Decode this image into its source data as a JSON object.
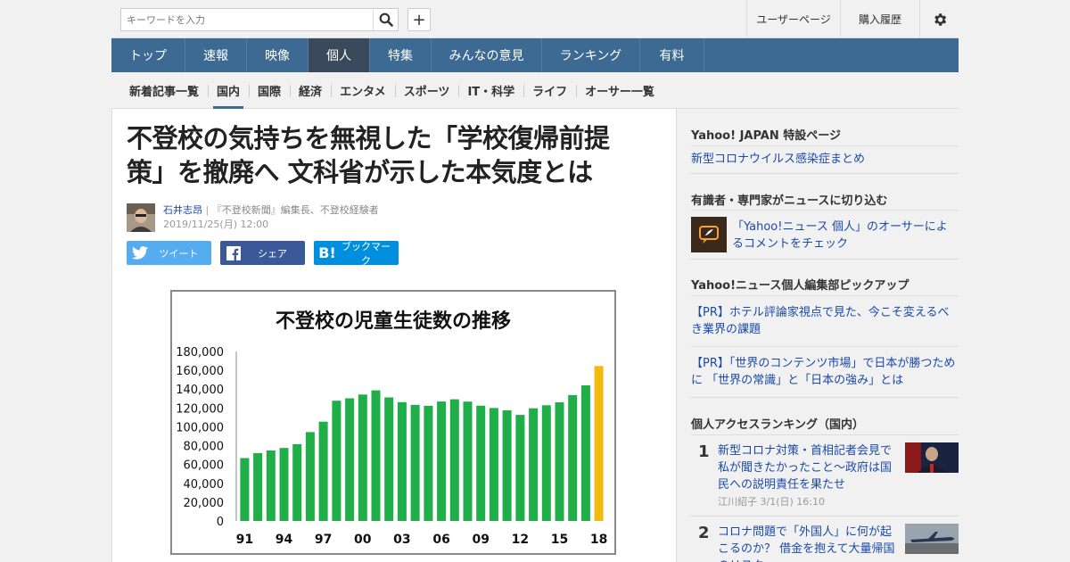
{
  "topbar": {
    "search_placeholder": "キーワードを入力",
    "user_page": "ユーザーページ",
    "purchase_history": "購入履歴"
  },
  "main_nav": [
    "トップ",
    "速報",
    "映像",
    "個人",
    "特集",
    "みんなの意見",
    "ランキング",
    "有料"
  ],
  "main_nav_active": "個人",
  "sub_nav": [
    "新着記事一覧",
    "国内",
    "国際",
    "経済",
    "エンタメ",
    "スポーツ",
    "IT・科学",
    "ライフ",
    "オーサー一覧"
  ],
  "sub_nav_active": "国内",
  "article": {
    "title_line1": "不登校の気持ちを無視した「学校復帰前提",
    "title_line2": "策」を撤廃へ 文科省が示した本気度とは",
    "author_name": "石井志昂",
    "author_sep": "|",
    "author_desc": "『不登校新聞』編集長、不登校経験者",
    "date": "2019/11/25(月) 12:00",
    "share_tweet": "ツイート",
    "share_facebook": "シェア",
    "share_hatena": "ブックマーク"
  },
  "chart_data": {
    "type": "bar",
    "title": "不登校の児童生徒数の推移",
    "x_tick_labels": [
      "91",
      "94",
      "97",
      "00",
      "03",
      "06",
      "09",
      "12",
      "15",
      "18"
    ],
    "categories": [
      "91",
      "92",
      "93",
      "94",
      "95",
      "96",
      "97",
      "98",
      "99",
      "00",
      "01",
      "02",
      "03",
      "04",
      "05",
      "06",
      "07",
      "08",
      "09",
      "10",
      "11",
      "12",
      "13",
      "14",
      "15",
      "16",
      "17",
      "18"
    ],
    "values": [
      66817,
      72131,
      74808,
      77449,
      81591,
      94351,
      105466,
      127692,
      130228,
      134286,
      138722,
      131252,
      126226,
      123358,
      122287,
      126894,
      129255,
      126805,
      122432,
      119891,
      117458,
      112689,
      119617,
      122897,
      125991,
      133683,
      144031,
      164528
    ],
    "ylim": [
      0,
      180000
    ],
    "y_ticks": [
      "180,000",
      "160,000",
      "140,000",
      "120,000",
      "100,000",
      "80,000",
      "60,000",
      "40,000",
      "20,000",
      "0"
    ],
    "colors": {
      "bar": "#1fae48",
      "highlight": "#f2b90f"
    },
    "highlight_last": true
  },
  "sidebar": {
    "special_heading": "Yahoo! JAPAN 特設ページ",
    "special_link": "新型コロナウイルス感染症まとめ",
    "experts_heading": "有識者・専門家がニュースに切り込む",
    "experts_link": "「Yahoo!ニュース 個人」のオーサーによるコメントをチェック",
    "pickup_heading": "Yahoo!ニュース個人編集部ピックアップ",
    "pickup_1": "【PR】ホテル評論家視点で見た、今こそ変えるべき業界の課題",
    "pickup_2": "【PR】「世界のコンテンツ市場」で日本が勝つために 「世界の常識」と「日本の強み」とは",
    "ranking_heading": "個人アクセスランキング（国内）",
    "ranking": [
      {
        "rank": "1",
        "title": "新型コロナ対策・首相記者会見で私が聞きたかったこと～政府は国民への説明責任を果たせ",
        "meta": "江川紹子 3/1(日) 16:10"
      },
      {
        "rank": "2",
        "title": "コロナ問題で「外国人」に何が起こるのか？ 借金を抱えて大量帰国のリスク",
        "meta": ""
      }
    ]
  }
}
